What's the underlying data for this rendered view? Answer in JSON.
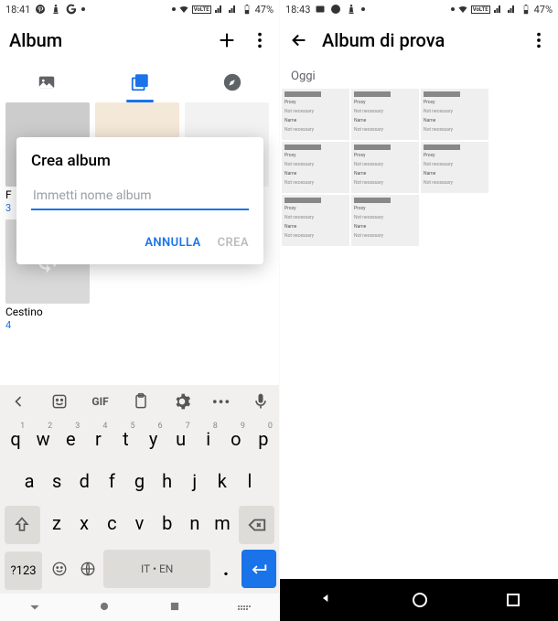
{
  "left": {
    "statusbar": {
      "time": "18:41",
      "battery": "47%"
    },
    "header": {
      "title": "Album"
    },
    "cells": {
      "photos": {
        "label": "F",
        "count": "3"
      },
      "trash": {
        "label": "Cestino",
        "count": "4"
      }
    },
    "dialog": {
      "title": "Crea album",
      "placeholder": "Immetti nome album",
      "cancel": "ANNULLA",
      "create": "CREA"
    },
    "keyboard": {
      "gif": "GIF",
      "row1": [
        "q",
        "w",
        "e",
        "r",
        "t",
        "y",
        "u",
        "i",
        "o",
        "p"
      ],
      "row1sup": [
        "1",
        "2",
        "3",
        "4",
        "5",
        "6",
        "7",
        "8",
        "9",
        "0"
      ],
      "row2": [
        "a",
        "s",
        "d",
        "f",
        "g",
        "h",
        "j",
        "k",
        "l"
      ],
      "row3": [
        "z",
        "x",
        "c",
        "v",
        "b",
        "n",
        "m"
      ],
      "sym": "?123",
      "space": "IT • EN",
      "period": "."
    }
  },
  "right": {
    "statusbar": {
      "time": "18:43",
      "battery": "47%"
    },
    "header": {
      "title": "Album di prova"
    },
    "section": "Oggi"
  }
}
